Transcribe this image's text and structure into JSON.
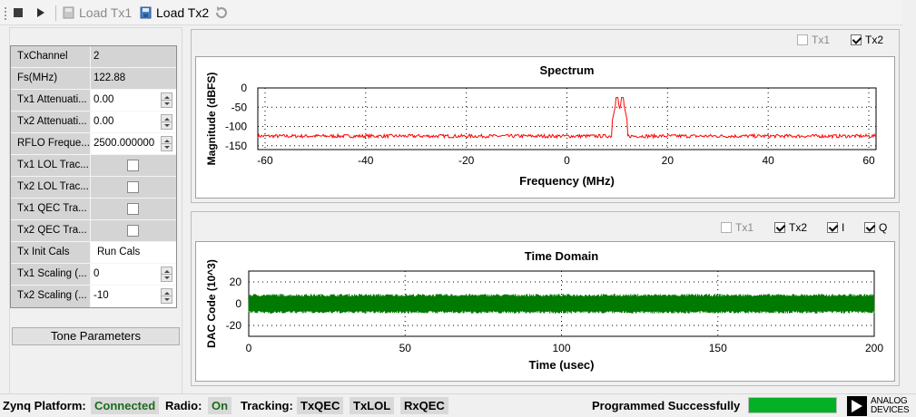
{
  "toolbar": {
    "stop_icon": "stop-icon",
    "play_icon": "play-icon",
    "load_tx1_label": "Load Tx1",
    "load_tx2_label": "Load Tx2",
    "refresh_icon": "refresh-icon"
  },
  "properties": [
    {
      "label": "TxChannel",
      "value": "2",
      "kind": "ro"
    },
    {
      "label": "Fs(MHz)",
      "value": "122.88",
      "kind": "ro"
    },
    {
      "label": "Tx1 Attenuati...",
      "value": "0.00",
      "kind": "spin"
    },
    {
      "label": "Tx2 Attenuati...",
      "value": "0.00",
      "kind": "spin"
    },
    {
      "label": "RFLO Freque...",
      "value": "2500.000000",
      "kind": "spin"
    },
    {
      "label": "Tx1 LOL Trac...",
      "value": "",
      "kind": "check"
    },
    {
      "label": "Tx2 LOL Trac...",
      "value": "",
      "kind": "check"
    },
    {
      "label": "Tx1 QEC Tra...",
      "value": "",
      "kind": "check"
    },
    {
      "label": "Tx2 QEC Tra...",
      "value": "",
      "kind": "check"
    },
    {
      "label": "Tx Init Cals",
      "value": "Run Cals",
      "kind": "button"
    },
    {
      "label": "Tx1 Scaling (...",
      "value": "0",
      "kind": "spin"
    },
    {
      "label": "Tx2 Scaling (...",
      "value": "-10",
      "kind": "spin"
    }
  ],
  "tone_parameters_label": "Tone Parameters",
  "spectrum_pane": {
    "legend": [
      {
        "label": "Tx1",
        "checked": false,
        "enabled": false
      },
      {
        "label": "Tx2",
        "checked": true,
        "enabled": true
      }
    ]
  },
  "time_pane": {
    "legend": [
      {
        "label": "Tx1",
        "checked": false,
        "enabled": false
      },
      {
        "label": "Tx2",
        "checked": true,
        "enabled": true
      },
      {
        "label": "I",
        "checked": true,
        "enabled": true
      },
      {
        "label": "Q",
        "checked": true,
        "enabled": true
      }
    ]
  },
  "chart_data": [
    {
      "type": "line",
      "title": "Spectrum",
      "xlabel": "Frequency (MHz)",
      "ylabel": "Magnitude (dBFS)",
      "xlim": [
        -61.44,
        61.44
      ],
      "ylim": [
        -160,
        0
      ],
      "x_ticks": [
        "-60",
        "-40",
        "-20",
        "0",
        "20",
        "40",
        "60"
      ],
      "y_ticks": [
        "0",
        "-50",
        "-100",
        "-150"
      ],
      "grid": true,
      "series": [
        {
          "color": "#ff0000",
          "noise_floor_dbfs": -125,
          "peaks": [
            {
              "x": 10,
              "y": -25
            },
            {
              "x": 11,
              "y": -25
            }
          ]
        }
      ]
    },
    {
      "type": "line",
      "title": "Time Domain",
      "xlabel": "Time (usec)",
      "ylabel": "DAC Code (10^3)",
      "xlim": [
        0,
        200
      ],
      "ylim": [
        -30,
        30
      ],
      "x_ticks": [
        "0",
        "50",
        "100",
        "150",
        "200"
      ],
      "y_ticks": [
        "20",
        "0",
        "-20"
      ],
      "grid": true,
      "series": [
        {
          "color": "#007a00",
          "amplitude": 9
        }
      ]
    }
  ],
  "status": {
    "platform_label": "Zynq Platform:",
    "platform_value": "Connected",
    "radio_label": "Radio:",
    "radio_value": "On",
    "tracking_label": "Tracking:",
    "tracking_items": [
      "TxQEC",
      "TxLOL",
      "RxQEC"
    ],
    "message": "Programmed Successfully",
    "progress": 1.0,
    "logo_line1": "ANALOG",
    "logo_line2": "DEVICES"
  }
}
